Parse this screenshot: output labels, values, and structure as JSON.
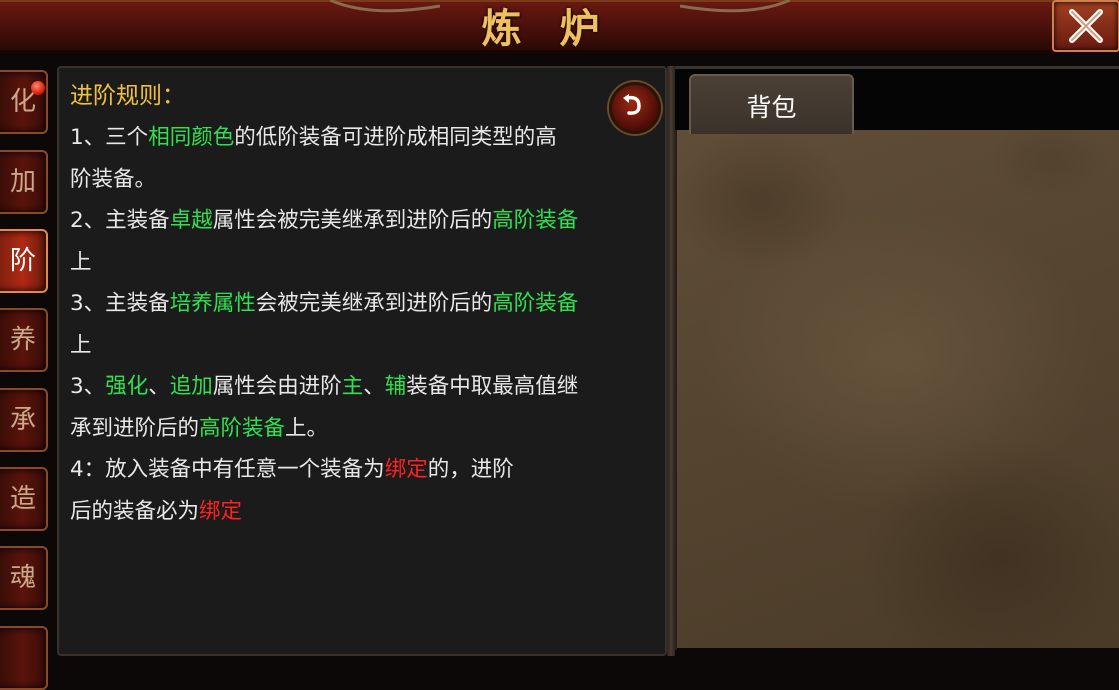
{
  "header": {
    "title": "炼炉"
  },
  "side_tabs": [
    {
      "label": "化",
      "has_badge": true
    },
    {
      "label": "加"
    },
    {
      "label": "阶",
      "active": true
    },
    {
      "label": "养"
    },
    {
      "label": "承"
    },
    {
      "label": "造"
    },
    {
      "label": "魂"
    }
  ],
  "rules": {
    "title": "进阶规则：",
    "lines": [
      {
        "parts": [
          {
            "t": "1、三个"
          },
          {
            "t": "相同颜色",
            "c": "g"
          },
          {
            "t": "的低阶装备可进阶成相同类型的高"
          }
        ]
      },
      {
        "parts": [
          {
            "t": "阶装备。"
          }
        ]
      },
      {
        "parts": [
          {
            "t": "2、主装备"
          },
          {
            "t": "卓越",
            "c": "g"
          },
          {
            "t": "属性会被完美继承到进阶后的"
          },
          {
            "t": "高阶装备",
            "c": "g"
          }
        ]
      },
      {
        "parts": [
          {
            "t": "上"
          }
        ]
      },
      {
        "parts": [
          {
            "t": "3、主装备"
          },
          {
            "t": "培养属性",
            "c": "g"
          },
          {
            "t": "会被完美继承到进阶后的"
          },
          {
            "t": "高阶装备",
            "c": "g"
          }
        ]
      },
      {
        "parts": [
          {
            "t": "上"
          }
        ]
      },
      {
        "parts": [
          {
            "t": "3、"
          },
          {
            "t": "强化",
            "c": "g"
          },
          {
            "t": "、"
          },
          {
            "t": "追加",
            "c": "g"
          },
          {
            "t": "属性会由进阶"
          },
          {
            "t": "主",
            "c": "g"
          },
          {
            "t": "、"
          },
          {
            "t": "辅",
            "c": "g"
          },
          {
            "t": "装备中取最高值继"
          }
        ]
      },
      {
        "parts": [
          {
            "t": "承到进阶后的"
          },
          {
            "t": "高阶装备",
            "c": "g"
          },
          {
            "t": "上。"
          }
        ]
      },
      {
        "parts": [
          {
            "t": "4：放入装备中有任意一个装备为"
          },
          {
            "t": "绑定",
            "c": "r"
          },
          {
            "t": "的，进阶"
          }
        ]
      },
      {
        "parts": [
          {
            "t": "后的装备必为"
          },
          {
            "t": "绑定",
            "c": "r"
          }
        ]
      }
    ]
  },
  "bag": {
    "tab_label": "背包"
  },
  "colors": {
    "highlight_green": "#30e050",
    "highlight_red": "#ff2020",
    "title_gold": "#f0c040"
  },
  "icons": {
    "close": "close-icon",
    "back": "return-arrow-icon"
  }
}
